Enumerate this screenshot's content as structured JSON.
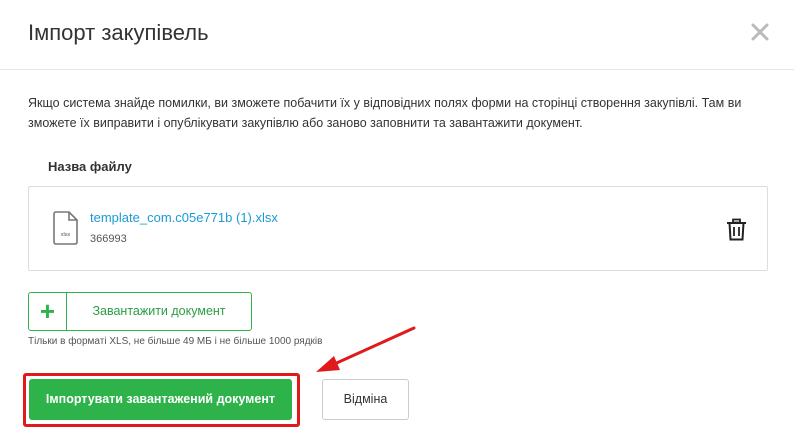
{
  "dialog": {
    "title": "Імпорт закупівель",
    "description": "Якщо система знайде помилки, ви зможете побачити їх у відповідних полях форми на сторінці створення закупівлі. Там ви зможете їх виправити і опублікувати закупівлю або заново заповнити та завантажити документ.",
    "icons": {
      "close": "close-icon"
    }
  },
  "file": {
    "section_label": "Назва файлу",
    "name": "template_com.c05e771b (1).xlsx",
    "size": "366993",
    "icon_text": "xlsx",
    "icons": {
      "file": "xlsx-file-icon",
      "delete": "trash-icon"
    }
  },
  "upload": {
    "plus": "+",
    "label": "Завантажити документ",
    "hint": "Тільки в форматі XLS, не більше 49 МБ і не більше 1000 рядків"
  },
  "actions": {
    "import_label": "Імпортувати завантажений документ",
    "cancel_label": "Відміна"
  },
  "colors": {
    "accent_green": "#2db34a",
    "link_blue": "#1a9bd7",
    "highlight_red": "#e01a1a"
  }
}
